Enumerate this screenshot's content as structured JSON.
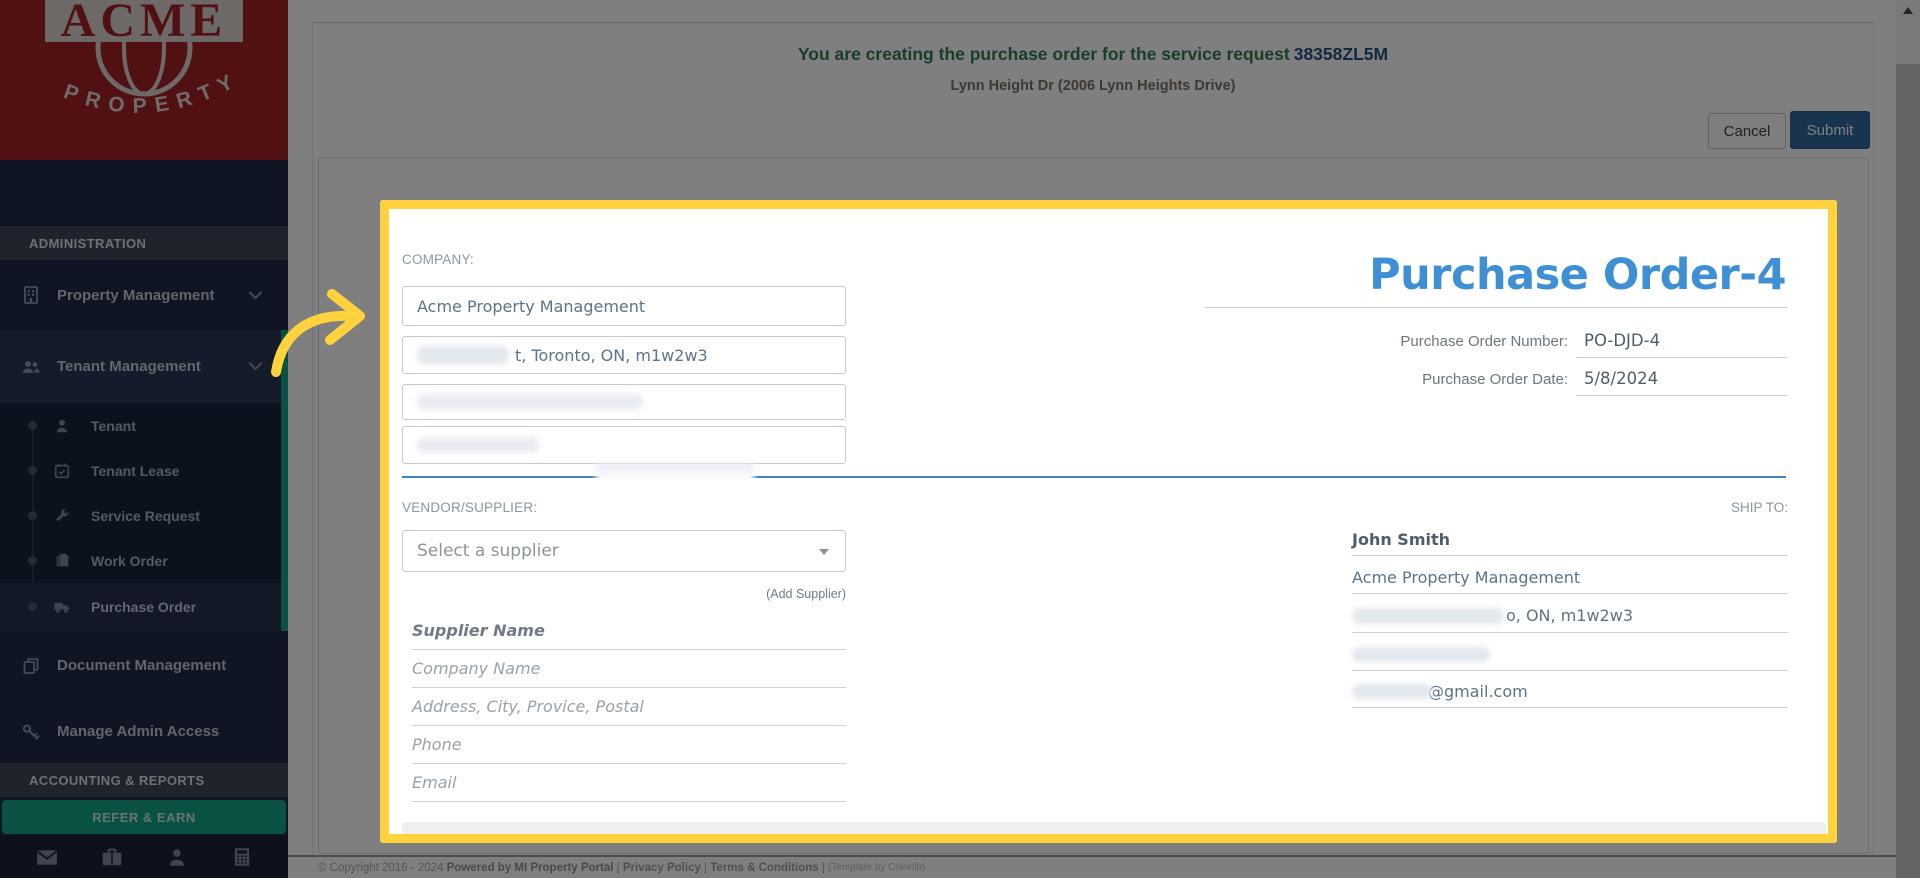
{
  "sidebar": {
    "logo": {
      "brand": "ACME",
      "word": "PROPERTY"
    },
    "admin_header": "ADMINISTRATION",
    "property_mgmt": "Property Management",
    "tenant_mgmt": "Tenant Management",
    "sub": [
      "Tenant",
      "Tenant Lease",
      "Service Request",
      "Work Order",
      "Purchase Order"
    ],
    "document_mgmt": "Document Management",
    "manage_admin": "Manage Admin Access",
    "accounting_header": "ACCOUNTING & REPORTS",
    "refer_earn": "REFER & EARN"
  },
  "header": {
    "creating_prefix": "You are creating the purchase order for the service request",
    "request_id": "38358ZL5M",
    "property_line": "Lynn Height Dr (2006 Lynn Heights Drive)",
    "cancel": "Cancel",
    "submit": "Submit"
  },
  "po_form": {
    "company_label": "COMPANY:",
    "company_name": "Acme Property Management",
    "company_address_visible": "t, Toronto, ON, m1w2w3",
    "title": "Purchase Order-4",
    "number_label": "Purchase Order Number:",
    "number": "PO-DJD-4",
    "date_label": "Purchase Order Date:",
    "date": "5/8/2024",
    "vendor_label": "VENDOR/SUPPLIER:",
    "supplier_placeholder": "Select a supplier",
    "add_supplier": "(Add Supplier)",
    "supplier_fields": [
      "Supplier Name",
      "Company Name",
      "Address, City, Provice, Postal",
      "Phone",
      "Email"
    ],
    "ship_to_label": "SHIP TO:",
    "ship_name": "John Smith",
    "ship_company": "Acme Property Management",
    "ship_address_visible": "o, ON, m1w2w3",
    "ship_email_visible": "@gmail.com"
  },
  "footer": {
    "copyright": "© Copyright 2016 - 2024 ",
    "powered": "Powered by MI Property Portal",
    "sep": " | ",
    "privacy": "Privacy Policy",
    "terms": "Terms & Conditions",
    "template": "(Template by Colorlib)"
  },
  "colors": {
    "highlight_yellow": "#ffd23e",
    "sidebar_red": "#a32226",
    "teal_accent": "#13a287",
    "title_blue": "#3f8fd4",
    "submit_blue": "#31699f",
    "success_green": "#2e7d4f"
  }
}
